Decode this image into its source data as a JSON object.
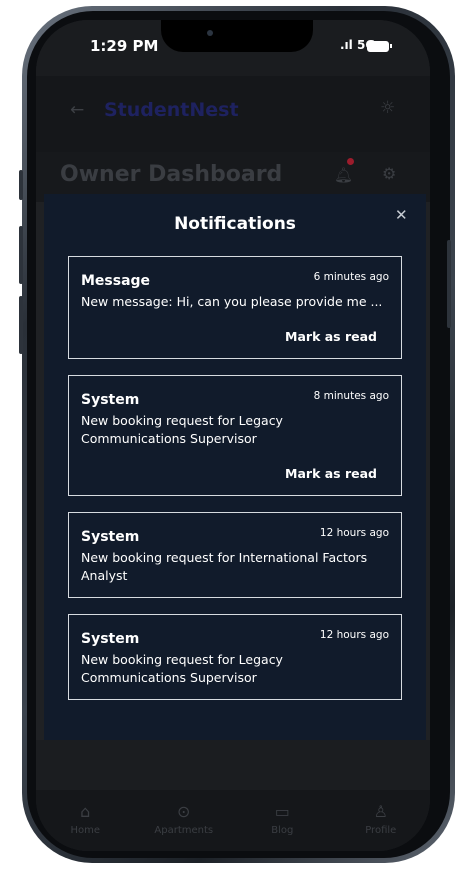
{
  "status_bar": {
    "time": "1:29 PM",
    "signal": "5G"
  },
  "header": {
    "brand": "StudentNest",
    "dashboard_title": "Owner Dashboard"
  },
  "modal": {
    "title": "Notifications",
    "items": [
      {
        "type": "Message",
        "time": "6 minutes ago",
        "message": "New message: Hi, can you please provide me ...",
        "action": "Mark as read"
      },
      {
        "type": "System",
        "time": "8 minutes ago",
        "message": "New booking request for Legacy Communications Supervisor",
        "action": "Mark as read"
      },
      {
        "type": "System",
        "time": "12 hours ago",
        "message": "New booking request for International Factors Analyst"
      },
      {
        "type": "System",
        "time": "12 hours ago",
        "message": "New booking request for Legacy Communications Supervisor"
      }
    ]
  },
  "bottom_nav": {
    "items": [
      {
        "label": "Home",
        "icon": "home-icon"
      },
      {
        "label": "Apartments",
        "icon": "location-pin-icon"
      },
      {
        "label": "Blog",
        "icon": "book-icon"
      },
      {
        "label": "Profile",
        "icon": "user-icon"
      }
    ]
  },
  "colors": {
    "modal_bg": "#111b2b",
    "badge_dot": "#9c1c2c",
    "brand": "#1e2260"
  }
}
